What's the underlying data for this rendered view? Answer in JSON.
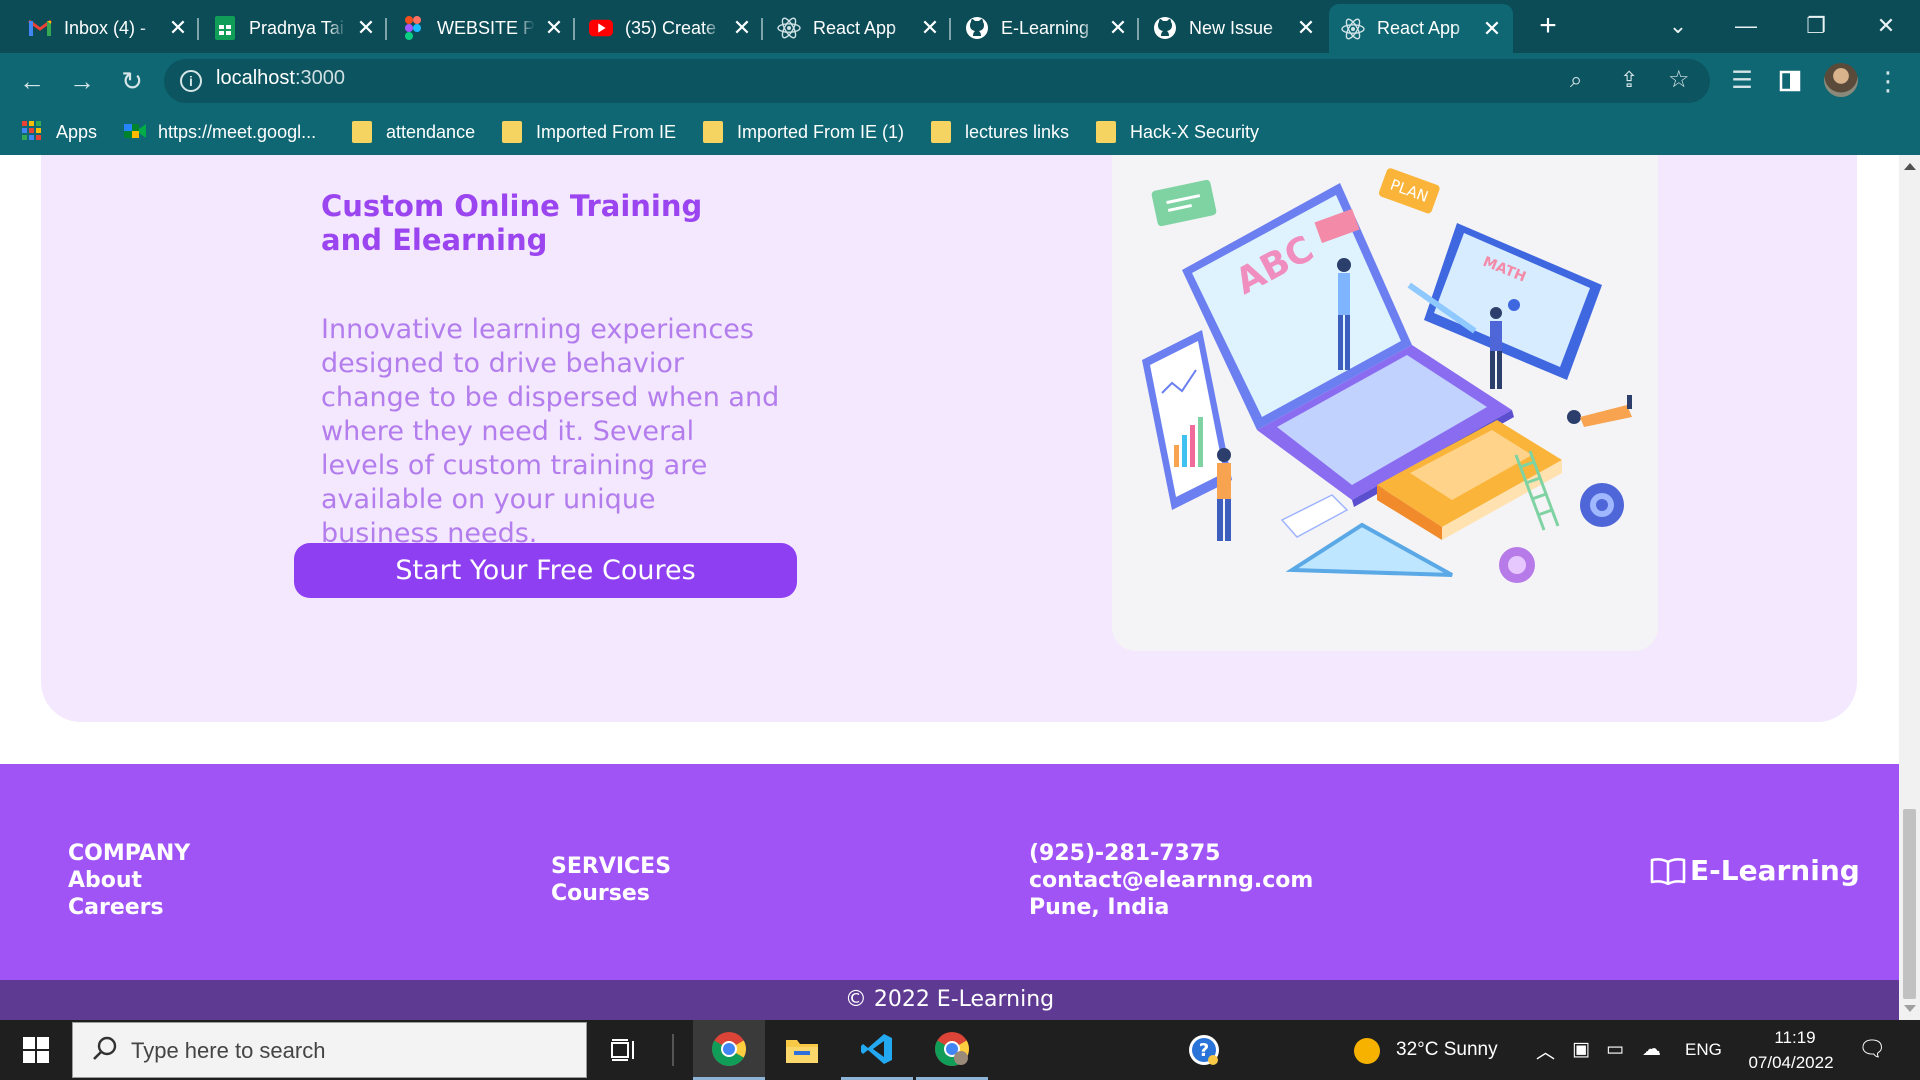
{
  "browser": {
    "tabs": [
      {
        "title": "Inbox (4) - ",
        "icon": "gmail-icon"
      },
      {
        "title": "Pradnya Tai",
        "icon": "sheets-icon"
      },
      {
        "title": "WEBSITE PO",
        "icon": "figma-icon"
      },
      {
        "title": "(35) Create",
        "icon": "youtube-icon"
      },
      {
        "title": "React App",
        "icon": "react-icon"
      },
      {
        "title": "E-Learning",
        "icon": "github-icon"
      },
      {
        "title": "New Issue",
        "icon": "github-icon"
      },
      {
        "title": "React App",
        "icon": "react-icon"
      }
    ],
    "url_host": "localhost",
    "url_port": ":3000",
    "bookmarks": [
      {
        "label": "Apps",
        "icon": "apps-grid-icon"
      },
      {
        "label": "https://meet.googl...",
        "icon": "meet-icon"
      },
      {
        "label": "attendance",
        "icon": "folder-icon"
      },
      {
        "label": "Imported From IE",
        "icon": "folder-icon"
      },
      {
        "label": "Imported From IE (1)",
        "icon": "folder-icon"
      },
      {
        "label": "lectures links",
        "icon": "folder-icon"
      },
      {
        "label": "Hack-X Security",
        "icon": "folder-icon"
      }
    ]
  },
  "hero": {
    "title": "Custom Online Training and Elearning",
    "text": "Innovative learning experiences designed to drive behavior change to be dispersed when and where they need it. Several levels of custom training are available on your unique business needs.",
    "cta_label": "Start Your Free Coures",
    "illustration_labels": {
      "abc": "ABC",
      "plan": "PLAN",
      "math": "MATH"
    }
  },
  "footer": {
    "company": {
      "heading": "COMPANY",
      "links": [
        "About",
        "Careers"
      ]
    },
    "services": {
      "heading": "SERVICES",
      "links": [
        "Courses"
      ]
    },
    "contact": {
      "phone": "(925)-281-7375",
      "email": "contact@elearnng.com",
      "location": "Pune, India"
    },
    "brand": "E-Learning",
    "copyright": "© 2022 E-Learning"
  },
  "taskbar": {
    "search_placeholder": "Type here to search",
    "weather": "32°C  Sunny",
    "language": "ENG",
    "time": "11:19",
    "date": "07/04/2022"
  },
  "colors": {
    "browser_frame": "#0f6773",
    "hero_bg": "#f3e8fd",
    "accent_purple": "#a154f6",
    "button_purple": "#8e3ff2",
    "copyright_bg": "#5f3a92"
  }
}
